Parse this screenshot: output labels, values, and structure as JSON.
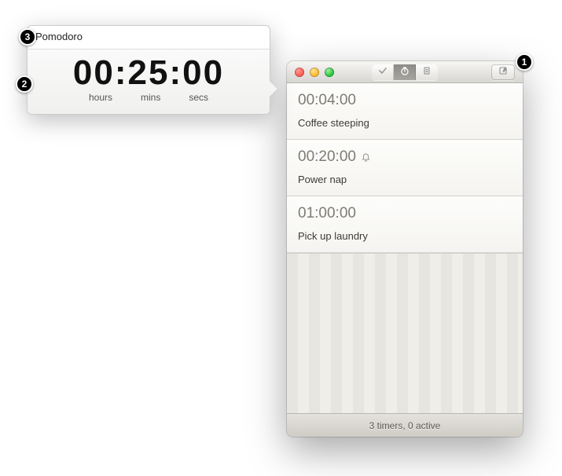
{
  "callouts": {
    "one": "1",
    "two": "2",
    "three": "3"
  },
  "popover": {
    "title": "Pomodoro",
    "time": {
      "hours": "00",
      "mins": "25",
      "secs": "00",
      "colon": ":"
    },
    "labels": {
      "hours": "hours",
      "mins": "mins",
      "secs": "secs"
    }
  },
  "window": {
    "timers": [
      {
        "time": "00:04:00",
        "label": "Coffee steeping",
        "alarm": false
      },
      {
        "time": "00:20:00",
        "label": "Power nap",
        "alarm": true
      },
      {
        "time": "01:00:00",
        "label": "Pick up laundry",
        "alarm": false
      }
    ],
    "status": "3 timers, 0 active"
  }
}
